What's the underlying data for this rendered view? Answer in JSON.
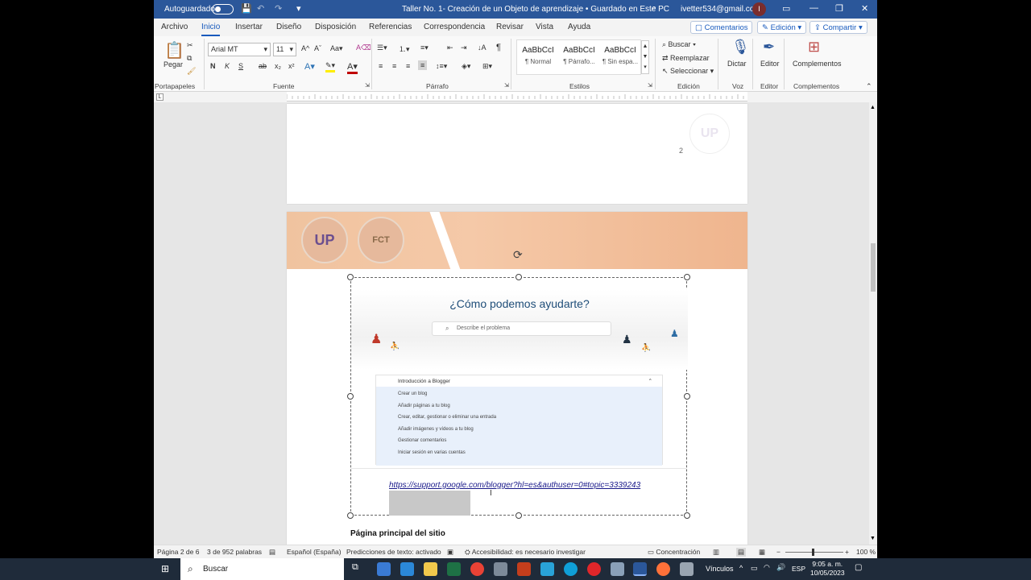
{
  "titlebar": {
    "autosave": "Autoguardado",
    "doc_title": "Taller No. 1- Creación de un Objeto de aprendizaje • Guardado en Este PC",
    "account": "ivetter534@gmail.com",
    "avatar": "I"
  },
  "tabs": [
    "Archivo",
    "Inicio",
    "Insertar",
    "Diseño",
    "Disposición",
    "Referencias",
    "Correspondencia",
    "Revisar",
    "Vista",
    "Ayuda"
  ],
  "tab_buttons": {
    "comments": "Comentarios",
    "editing": "Edición",
    "share": "Compartir"
  },
  "ribbon": {
    "paste": "Pegar",
    "font_name": "Arial MT",
    "font_size": "11",
    "bold": "N",
    "italic": "K",
    "underline": "S",
    "styles": [
      {
        "sample": "AaBbCcI",
        "name": "¶ Normal"
      },
      {
        "sample": "AaBbCcI",
        "name": "¶ Párrafo..."
      },
      {
        "sample": "AaBbCcI",
        "name": "¶ Sin espa..."
      }
    ],
    "find": "Buscar",
    "replace": "Reemplazar",
    "select": "Seleccionar",
    "dictate": "Dictar",
    "editor": "Editor",
    "addins": "Complementos",
    "groups": {
      "clipboard": "Portapapeles",
      "font": "Fuente",
      "paragraph": "Párrafo",
      "styles": "Estilos",
      "editing": "Edición",
      "voice": "Voz",
      "editor": "Editor",
      "addins": "Complementos"
    }
  },
  "document": {
    "page_number": "2",
    "help_title": "¿Cómo podemos ayudarte?",
    "search_placeholder": "Describe el problema",
    "panel_header": "Introducción a Blogger",
    "panel_items": [
      "Crear un blog",
      "Añadir páginas a tu blog",
      "Crear, editar, gestionar o eliminar una entrada",
      "Añadir imágenes y vídeos a tu blog",
      "Gestionar comentarios",
      "Iniciar sesión en varias cuentas"
    ],
    "link": "https://support.google.com/blogger?hl=es&authuser=0#topic=3339243",
    "caption": "Página principal del sitio"
  },
  "status": {
    "page": "Página 2 de 6",
    "words": "3 de 952 palabras",
    "language": "Español (España)",
    "predictions": "Predicciones de texto: activado",
    "accessibility": "Accesibilidad: es necesario investigar",
    "focus": "Concentración",
    "zoom": "100 %"
  },
  "taskbar": {
    "search": "Buscar",
    "links": "Vínculos",
    "lang": "ESP",
    "time": "9:05 a. m.",
    "date": "10/05/2023"
  }
}
